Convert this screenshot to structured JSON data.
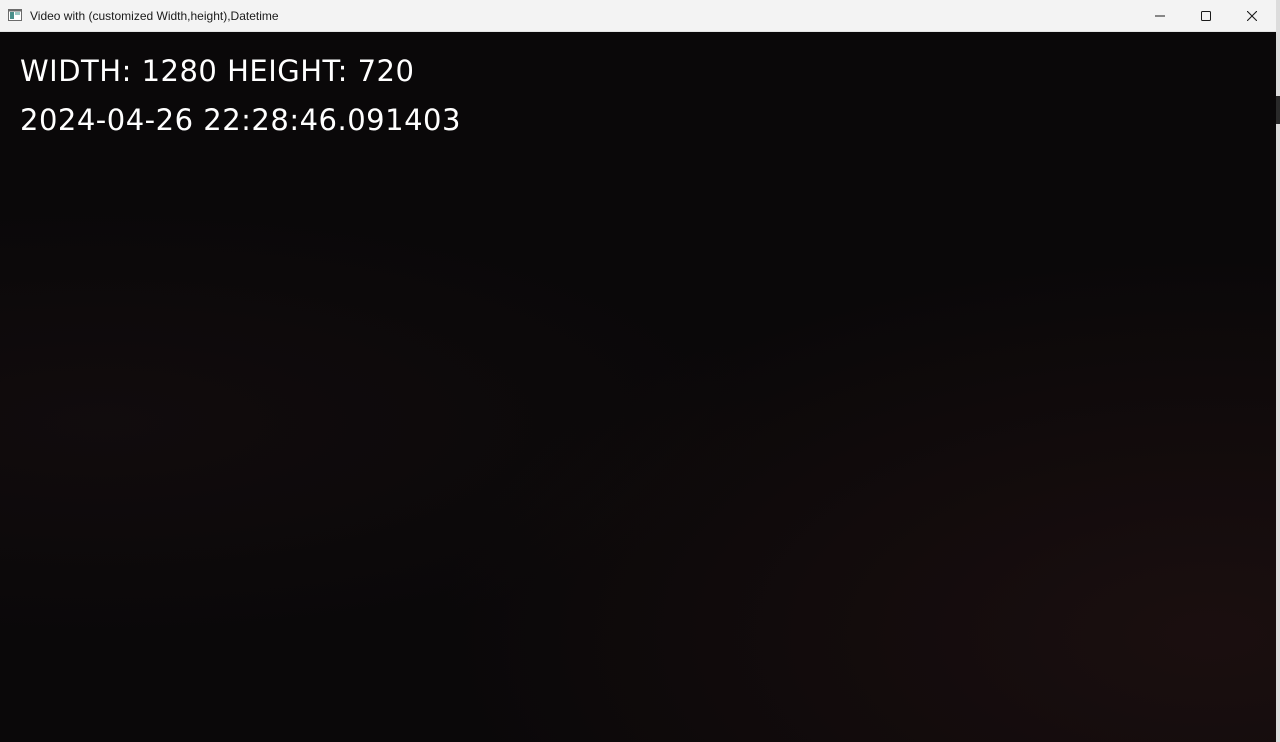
{
  "window": {
    "title": "Video with (customized Width,height),Datetime",
    "app_icon": "window-app-icon",
    "controls": {
      "minimize_icon": "minimize-icon",
      "maximize_icon": "maximize-icon",
      "close_icon": "close-icon"
    }
  },
  "video": {
    "overlay": {
      "dimensions_text": "WIDTH: 1280 HEIGHT: 720",
      "datetime_text": "2024-04-26 22:28:46.091403"
    },
    "background_color": "#0a0809",
    "text_color": "#ffffff"
  }
}
